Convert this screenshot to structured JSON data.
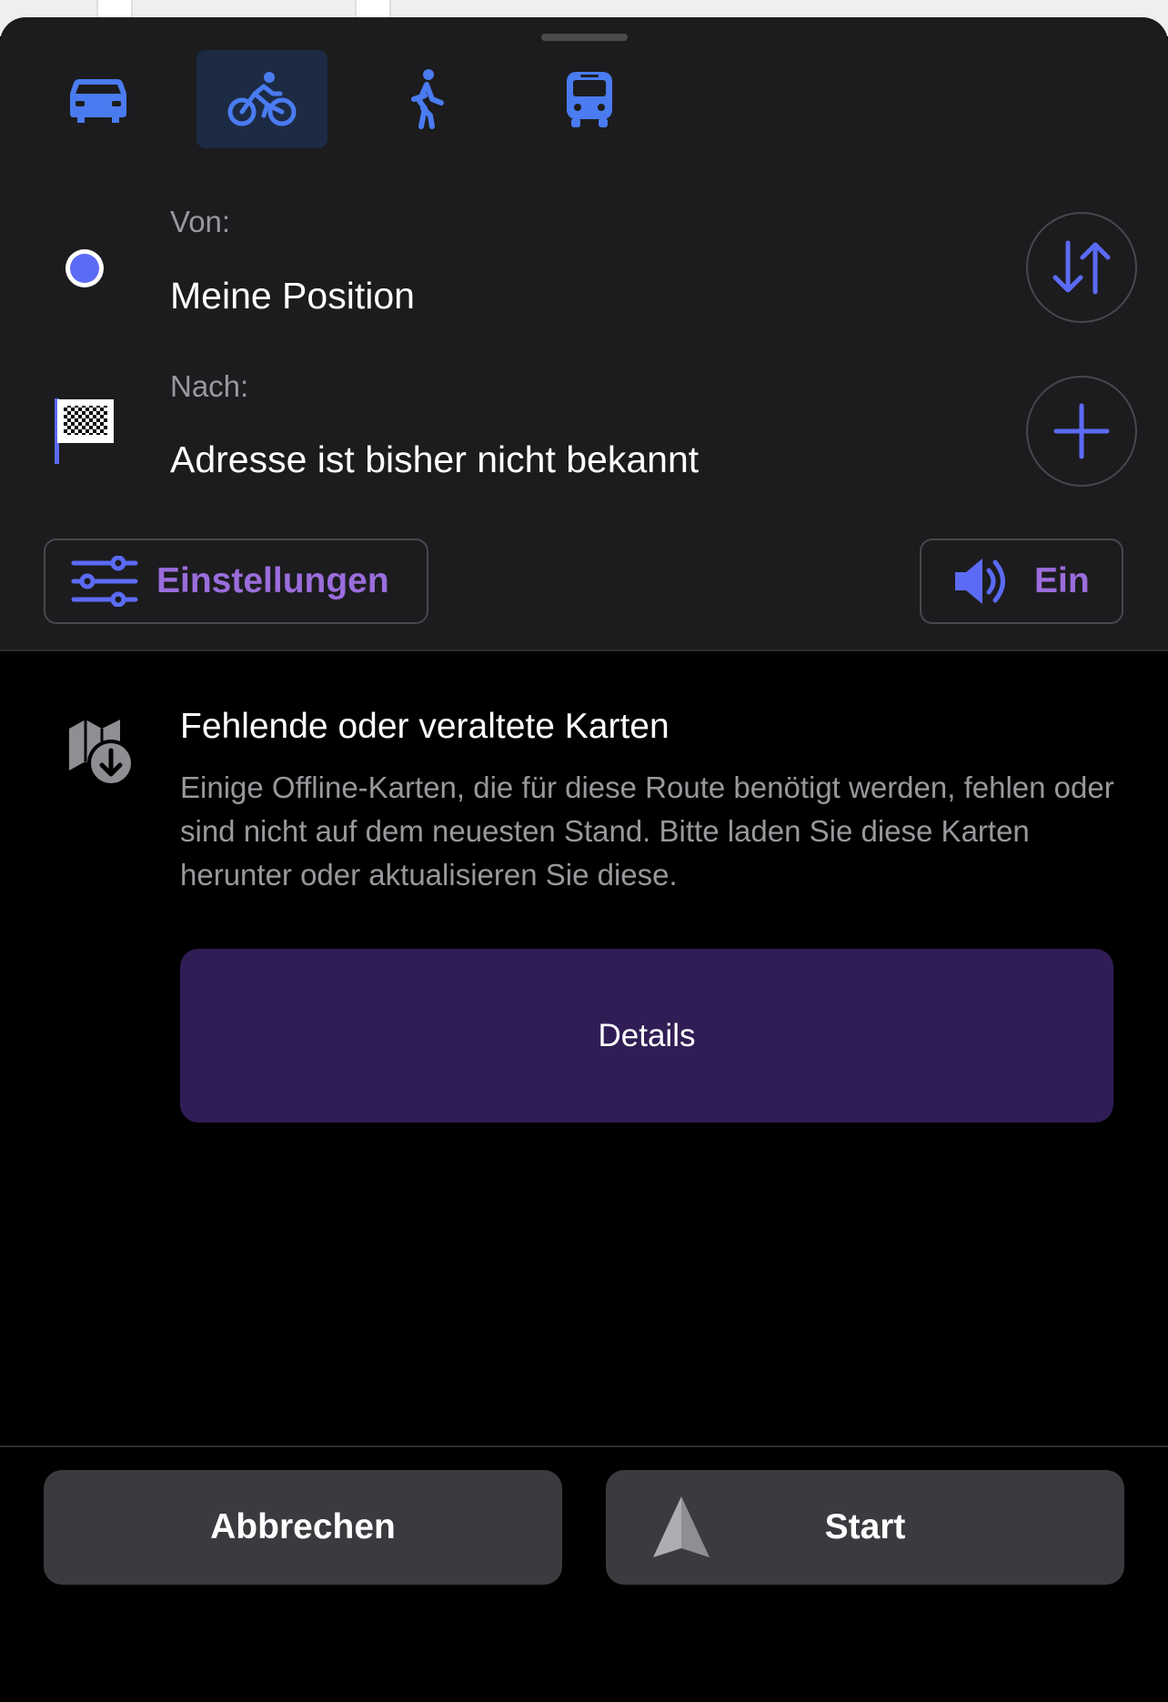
{
  "colors": {
    "accent": "#5b6bf5",
    "settings_text": "#9a6ddc",
    "details_bg": "#301d55",
    "sheet_bg": "#1c1c1e"
  },
  "modes": [
    {
      "icon": "car-icon",
      "active": false
    },
    {
      "icon": "bicycle-icon",
      "active": true
    },
    {
      "icon": "pedestrian-icon",
      "active": false
    },
    {
      "icon": "bus-icon",
      "active": false
    }
  ],
  "from": {
    "label": "Von:",
    "value": "Meine Position"
  },
  "to": {
    "label": "Nach:",
    "value": "Adresse ist bisher nicht bekannt"
  },
  "settings": {
    "label": "Einstellungen"
  },
  "sound": {
    "label": "Ein"
  },
  "warning": {
    "title": "Fehlende oder veraltete Karten",
    "text": "Einige Offline-Karten, die für diese Route benötigt werden, fehlen oder sind nicht auf dem neuesten Stand. Bitte laden Sie diese Karten herunter oder aktualisieren Sie diese.",
    "details_label": "Details"
  },
  "actions": {
    "cancel_label": "Abbrechen",
    "start_label": "Start"
  }
}
